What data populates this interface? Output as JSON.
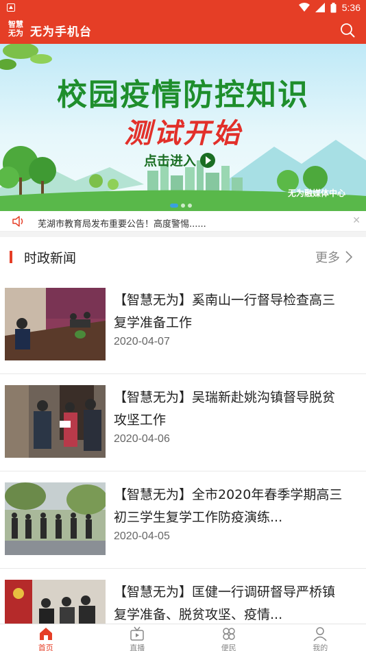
{
  "status_bar": {
    "time": "5:36"
  },
  "app_bar": {
    "logo_text_1": "智慧",
    "logo_text_2": "无为",
    "title": "无为手机台"
  },
  "banner": {
    "headline_1": "校园疫情防控知识",
    "headline_2": "测试开始",
    "enter_label": "点击进入",
    "org_label": "无为融媒体中心",
    "slide_count": 3,
    "active_slide": 0
  },
  "notice": {
    "text": "芜湖市教育局发布重要公告！高度警惕......"
  },
  "section": {
    "title": "时政新闻",
    "more_label": "更多"
  },
  "news": [
    {
      "title": "【智慧无为】奚南山一行督导检查高三复学准备工作",
      "date": "2020-04-07"
    },
    {
      "title": "【智慧无为】吴瑞新赴姚沟镇督导脱贫攻坚工作",
      "date": "2020-04-06"
    },
    {
      "title": "【智慧无为】全市2020年春季学期高三初三学生复学工作防疫演练...",
      "date": "2020-04-05"
    },
    {
      "title": "【智慧无为】匡健一行调研督导严桥镇复学准备、脱贫攻坚、疫情...",
      "date": ""
    }
  ],
  "bottom_nav": [
    {
      "label": "首页",
      "icon": "home-icon",
      "active": true
    },
    {
      "label": "直播",
      "icon": "live-tv-icon",
      "active": false
    },
    {
      "label": "便民",
      "icon": "services-icon",
      "active": false
    },
    {
      "label": "我的",
      "icon": "profile-icon",
      "active": false
    }
  ],
  "colors": {
    "brand_red": "#e53e26",
    "banner_green": "#1e8e2c",
    "banner_red": "#e2302a"
  }
}
